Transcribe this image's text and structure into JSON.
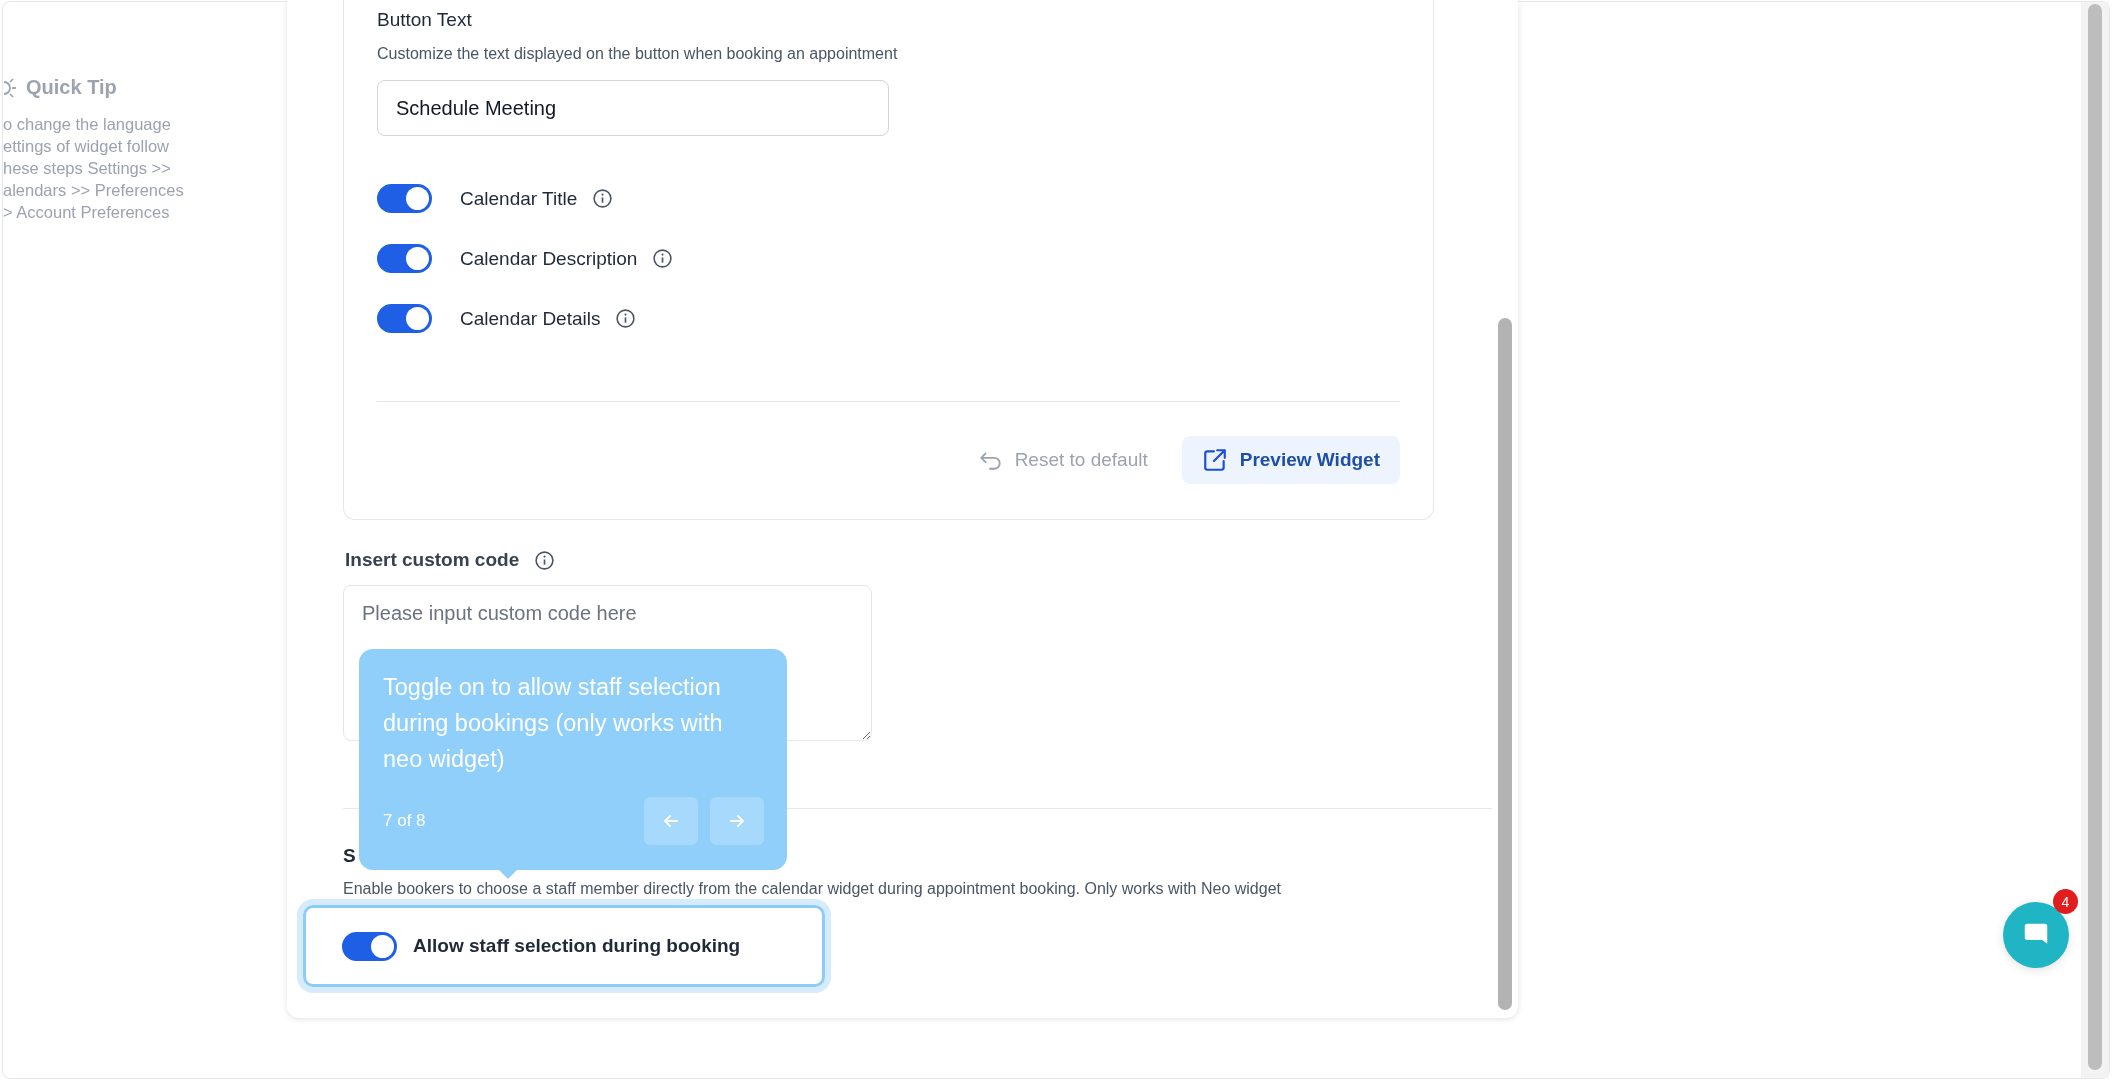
{
  "sidebar": {
    "quick_tip": {
      "title": "Quick Tip",
      "lines": [
        "o change the language",
        "ettings of widget follow",
        "hese steps Settings >>",
        "alendars >> Preferences",
        "> Account Preferences"
      ]
    }
  },
  "widget_settings": {
    "button_text": {
      "label": "Button Text",
      "description": "Customize the text displayed on the button when booking an appointment",
      "value": "Schedule Meeting"
    },
    "toggles": [
      {
        "label": "Calendar Title",
        "on": true
      },
      {
        "label": "Calendar Description",
        "on": true
      },
      {
        "label": "Calendar Details",
        "on": true
      }
    ],
    "actions": {
      "reset": "Reset to default",
      "preview": "Preview Widget"
    }
  },
  "custom_code": {
    "label": "Insert custom code",
    "placeholder": "Please input custom code here"
  },
  "staff_selection": {
    "heading": "S",
    "description": "Enable bookers to choose a staff member directly from the calendar widget during appointment booking. Only works with Neo widget",
    "toggle": {
      "label": "Allow staff selection during booking",
      "on": true,
      "highlighted": true
    }
  },
  "tour_tooltip": {
    "text": "Toggle on to allow staff selection during bookings (only works with neo widget)",
    "step": "7 of 8"
  },
  "chat_button": {
    "badge": "4"
  }
}
